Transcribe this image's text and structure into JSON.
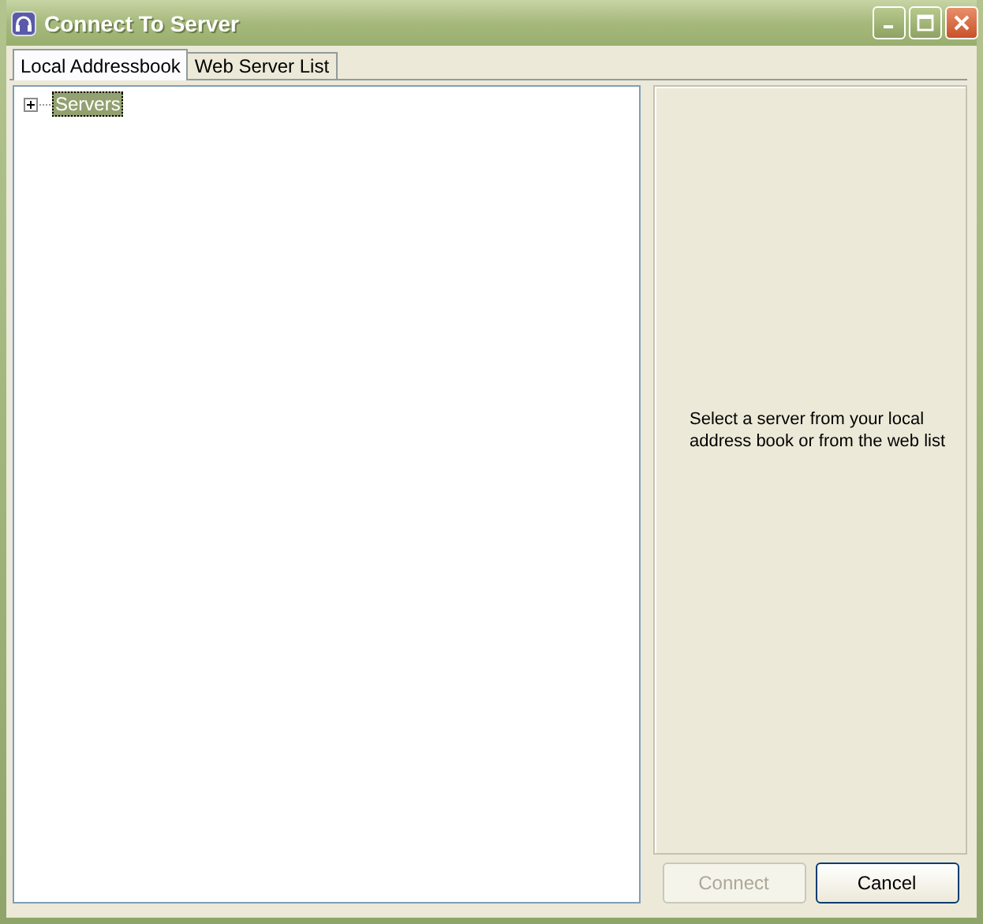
{
  "window": {
    "title": "Connect To Server"
  },
  "tabs": [
    {
      "label": "Local Addressbook",
      "selected": true
    },
    {
      "label": "Web Server List",
      "selected": false
    }
  ],
  "tree": [
    {
      "label": "Servers",
      "expanded": false,
      "selected": true
    }
  ],
  "info": {
    "text": "Select a server from your local address book or from the web list"
  },
  "buttons": [
    {
      "label": "Connect",
      "disabled": true
    },
    {
      "label": "Cancel",
      "disabled": false
    }
  ]
}
